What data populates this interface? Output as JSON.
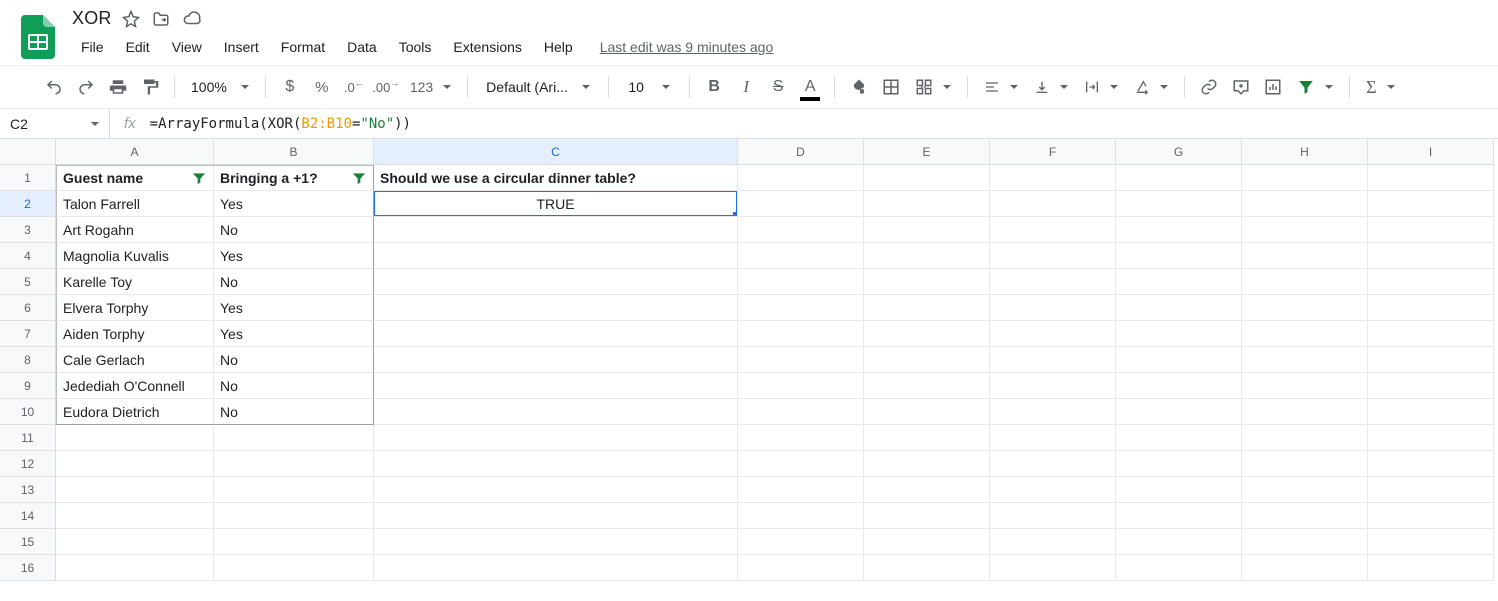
{
  "doc": {
    "title": "XOR",
    "last_edit": "Last edit was 9 minutes ago"
  },
  "menus": [
    "File",
    "Edit",
    "View",
    "Insert",
    "Format",
    "Data",
    "Tools",
    "Extensions",
    "Help"
  ],
  "toolbar": {
    "zoom": "100%",
    "font": "Default (Ari...",
    "font_size": "10"
  },
  "namebox": "C2",
  "formula": {
    "prefix": "=ArrayFormula(XOR(",
    "range": "B2:B10",
    "mid": "=",
    "string": "\"No\"",
    "suffix": "))"
  },
  "columns": [
    "A",
    "B",
    "C",
    "D",
    "E",
    "F",
    "G",
    "H",
    "I"
  ],
  "headers": {
    "A": "Guest name",
    "B": "Bringing a +1?",
    "C": "Should we use a circular dinner table?"
  },
  "rows": [
    {
      "A": "Talon Farrell",
      "B": "Yes",
      "C": "TRUE"
    },
    {
      "A": "Art Rogahn",
      "B": "No"
    },
    {
      "A": "Magnolia Kuvalis",
      "B": "Yes"
    },
    {
      "A": "Karelle Toy",
      "B": "No"
    },
    {
      "A": "Elvera Torphy",
      "B": "Yes"
    },
    {
      "A": "Aiden Torphy",
      "B": "Yes"
    },
    {
      "A": "Cale Gerlach",
      "B": "No"
    },
    {
      "A": "Jedediah O'Connell",
      "B": "No"
    },
    {
      "A": "Eudora Dietrich",
      "B": "No"
    }
  ],
  "selected_cell": "C2",
  "selected_col": "C",
  "selected_row": 2,
  "total_rows": 16
}
